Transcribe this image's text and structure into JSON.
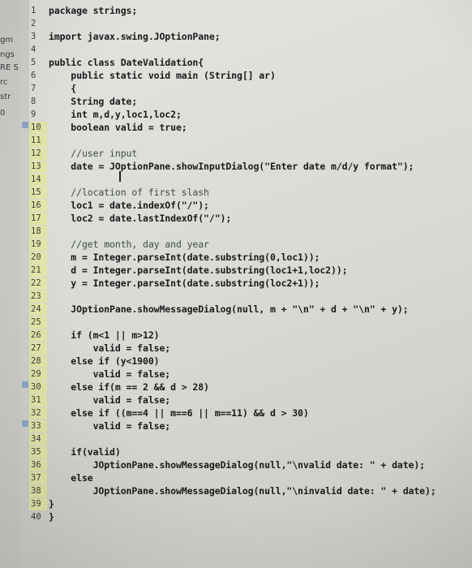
{
  "left_panel": {
    "items": [
      {
        "text": "gm"
      },
      {
        "text": "ngs"
      },
      {
        "text": "RE S"
      },
      {
        "text": "rc"
      },
      {
        "text": "str"
      },
      {
        "text": "0"
      }
    ]
  },
  "editor": {
    "lines": [
      {
        "n": "1",
        "text": "package strings;"
      },
      {
        "n": "2",
        "text": ""
      },
      {
        "n": "3",
        "text": "import javax.swing.JOptionPane;"
      },
      {
        "n": "4",
        "text": ""
      },
      {
        "n": "5",
        "text": "public class DateValidation{"
      },
      {
        "n": "6",
        "text": "    public static void main (String[] ar)"
      },
      {
        "n": "7",
        "text": "    {"
      },
      {
        "n": "8",
        "text": "    String date;"
      },
      {
        "n": "9",
        "text": "    int m,d,y,loc1,loc2;"
      },
      {
        "n": "10",
        "text": "    boolean valid = true;"
      },
      {
        "n": "11",
        "text": ""
      },
      {
        "n": "12",
        "text": "    //user input"
      },
      {
        "n": "13",
        "text": "    date = JOptionPane.showInputDialog(\"Enter date m/d/y format\");"
      },
      {
        "n": "14",
        "text": ""
      },
      {
        "n": "15",
        "text": "    //location of first slash"
      },
      {
        "n": "16",
        "text": "    loc1 = date.indexOf(\"/\");"
      },
      {
        "n": "17",
        "text": "    loc2 = date.lastIndexOf(\"/\");"
      },
      {
        "n": "18",
        "text": ""
      },
      {
        "n": "19",
        "text": "    //get month, day and year"
      },
      {
        "n": "20",
        "text": "    m = Integer.parseInt(date.substring(0,loc1));"
      },
      {
        "n": "21",
        "text": "    d = Integer.parseInt(date.substring(loc1+1,loc2));"
      },
      {
        "n": "22",
        "text": "    y = Integer.parseInt(date.substring(loc2+1));"
      },
      {
        "n": "23",
        "text": ""
      },
      {
        "n": "24",
        "text": "    JOptionPane.showMessageDialog(null, m + \"\\n\" + d + \"\\n\" + y);"
      },
      {
        "n": "25",
        "text": ""
      },
      {
        "n": "26",
        "text": "    if (m<1 || m>12)"
      },
      {
        "n": "27",
        "text": "        valid = false;"
      },
      {
        "n": "28",
        "text": "    else if (y<1900)"
      },
      {
        "n": "29",
        "text": "        valid = false;"
      },
      {
        "n": "30",
        "text": "    else if(m == 2 && d > 28)"
      },
      {
        "n": "31",
        "text": "        valid = false;"
      },
      {
        "n": "32",
        "text": "    else if ((m==4 || m==6 || m==11) && d > 30)"
      },
      {
        "n": "33",
        "text": "        valid = false;"
      },
      {
        "n": "34",
        "text": ""
      },
      {
        "n": "35",
        "text": "    if(valid)"
      },
      {
        "n": "36",
        "text": "        JOptionPane.showMessageDialog(null,\"\\nvalid date: \" + date);"
      },
      {
        "n": "37",
        "text": "    else"
      },
      {
        "n": "38",
        "text": "        JOptionPane.showMessageDialog(null,\"\\ninvalid date: \" + date);"
      },
      {
        "n": "39",
        "text": "}"
      },
      {
        "n": "40",
        "text": "}"
      }
    ]
  }
}
